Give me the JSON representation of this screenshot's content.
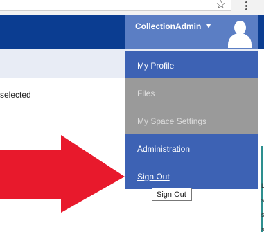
{
  "browser": {
    "star_icon": "star-outline-icon",
    "menu_icon": "kebab-menu-icon"
  },
  "header": {
    "username": "CollectionAdmin",
    "caret": "▼",
    "accent_color": "#0b3d91",
    "user_area_color": "#5b7ec4"
  },
  "main": {
    "selected_text": "selected"
  },
  "dropdown": {
    "items": [
      {
        "label": "My Profile",
        "enabled": true
      },
      {
        "label": "Files",
        "enabled": false
      },
      {
        "label": "My Space Settings",
        "enabled": false
      },
      {
        "label": "Administration",
        "enabled": true
      },
      {
        "label": "Sign Out",
        "enabled": true
      }
    ],
    "active_color": "#3d62b4",
    "disabled_color": "#9a9a9a"
  },
  "tooltip": {
    "text": "Sign Out"
  },
  "annotation": {
    "arrow_color": "#e8192c"
  },
  "right_edge": {
    "letters": [
      "L",
      "s",
      "s",
      "s"
    ]
  }
}
